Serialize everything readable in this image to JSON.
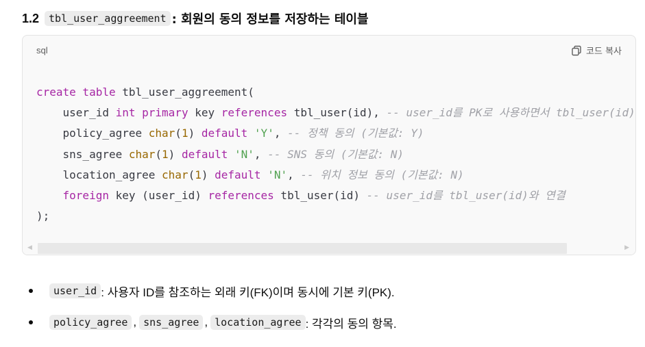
{
  "heading": {
    "number": "1.2",
    "code": "tbl_user_aggreement",
    "text": ": 회원의 동의 정보를 저장하는 테이블"
  },
  "codeblock": {
    "language": "sql",
    "copy_label": "코드 복사",
    "lines": [
      [
        {
          "t": "create table",
          "c": "kw"
        },
        {
          "t": " tbl_user_aggreement(",
          "c": ""
        }
      ],
      [
        {
          "t": "    user_id ",
          "c": ""
        },
        {
          "t": "int",
          "c": "kw"
        },
        {
          "t": " ",
          "c": ""
        },
        {
          "t": "primary",
          "c": "kw"
        },
        {
          "t": " key ",
          "c": ""
        },
        {
          "t": "references",
          "c": "kw"
        },
        {
          "t": " tbl_user(id), ",
          "c": ""
        },
        {
          "t": "-- user_id를 PK로 사용하면서 tbl_user(id)와 연결",
          "c": "cm"
        }
      ],
      [
        {
          "t": "    policy_agree ",
          "c": ""
        },
        {
          "t": "char",
          "c": "ty"
        },
        {
          "t": "(",
          "c": ""
        },
        {
          "t": "1",
          "c": "nm"
        },
        {
          "t": ") ",
          "c": ""
        },
        {
          "t": "default",
          "c": "kw"
        },
        {
          "t": " ",
          "c": ""
        },
        {
          "t": "'Y'",
          "c": "st"
        },
        {
          "t": ", ",
          "c": ""
        },
        {
          "t": "-- 정책 동의 (기본값: Y)",
          "c": "cm"
        }
      ],
      [
        {
          "t": "    sns_agree ",
          "c": ""
        },
        {
          "t": "char",
          "c": "ty"
        },
        {
          "t": "(",
          "c": ""
        },
        {
          "t": "1",
          "c": "nm"
        },
        {
          "t": ") ",
          "c": ""
        },
        {
          "t": "default",
          "c": "kw"
        },
        {
          "t": " ",
          "c": ""
        },
        {
          "t": "'N'",
          "c": "st"
        },
        {
          "t": ", ",
          "c": ""
        },
        {
          "t": "-- SNS 동의 (기본값: N)",
          "c": "cm"
        }
      ],
      [
        {
          "t": "    location_agree ",
          "c": ""
        },
        {
          "t": "char",
          "c": "ty"
        },
        {
          "t": "(",
          "c": ""
        },
        {
          "t": "1",
          "c": "nm"
        },
        {
          "t": ") ",
          "c": ""
        },
        {
          "t": "default",
          "c": "kw"
        },
        {
          "t": " ",
          "c": ""
        },
        {
          "t": "'N'",
          "c": "st"
        },
        {
          "t": ", ",
          "c": ""
        },
        {
          "t": "-- 위치 정보 동의 (기본값: N)",
          "c": "cm"
        }
      ],
      [
        {
          "t": "    ",
          "c": ""
        },
        {
          "t": "foreign",
          "c": "kw"
        },
        {
          "t": " key (user_id) ",
          "c": ""
        },
        {
          "t": "references",
          "c": "kw"
        },
        {
          "t": " tbl_user(id) ",
          "c": ""
        },
        {
          "t": "-- user_id를 tbl_user(id)와 연결",
          "c": "cm"
        }
      ],
      [
        {
          "t": ");",
          "c": ""
        }
      ]
    ]
  },
  "bullets": [
    {
      "codes": [
        "user_id"
      ],
      "text": ": 사용자 ID를 참조하는 외래 키(FK)이며 동시에 기본 키(PK)."
    },
    {
      "codes": [
        "policy_agree",
        "sns_agree",
        "location_agree"
      ],
      "text": ": 각각의 동의 항목."
    }
  ],
  "icons": {
    "copy": "copy-icon",
    "bullet": "bullet-dot"
  },
  "colors": {
    "keyword": "#a626a4",
    "type": "#986801",
    "string": "#50a14f",
    "comment": "#a0a1a7",
    "code_bg": "#f9f9f9",
    "inline_code_bg": "#ececec"
  }
}
